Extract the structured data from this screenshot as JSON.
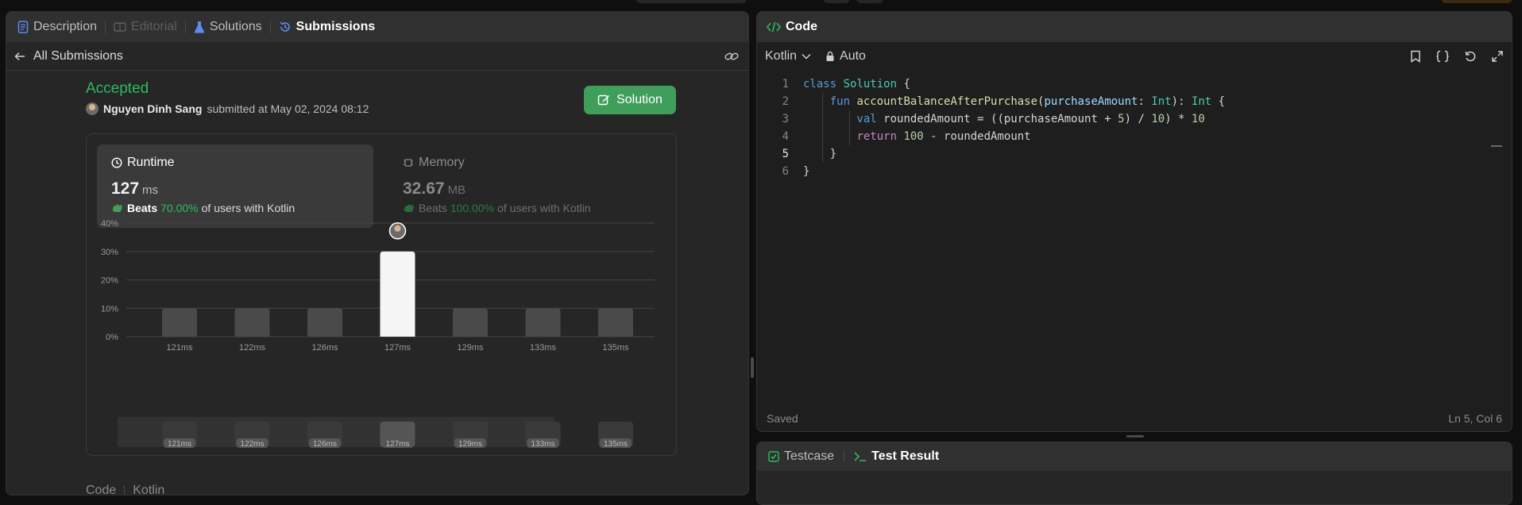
{
  "tabs": [
    {
      "label": "Description",
      "state": "normal",
      "icon": "description-icon"
    },
    {
      "label": "Editorial",
      "state": "disabled",
      "icon": "editorial-icon"
    },
    {
      "label": "Solutions",
      "state": "normal",
      "icon": "flask-icon"
    },
    {
      "label": "Submissions",
      "state": "active",
      "icon": "history-icon"
    }
  ],
  "subbar": {
    "back_label": "All Submissions"
  },
  "submission": {
    "status": "Accepted",
    "user": "Nguyen Dinh Sang",
    "submitted_text": "submitted at May 02, 2024 08:12",
    "solution_button": "Solution"
  },
  "runtime": {
    "title": "Runtime",
    "value": "127",
    "unit": "ms",
    "beats_label": "Beats",
    "beats_pct": "70.00%",
    "beats_suffix": "of users with Kotlin"
  },
  "memory": {
    "title": "Memory",
    "value": "32.67",
    "unit": "MB",
    "beats_label": "Beats",
    "beats_pct": "100.00%",
    "beats_suffix": "of users with Kotlin"
  },
  "chart_data": {
    "type": "bar",
    "categories": [
      "121ms",
      "122ms",
      "126ms",
      "127ms",
      "129ms",
      "133ms",
      "135ms"
    ],
    "values": [
      10,
      10,
      10,
      30,
      10,
      10,
      10
    ],
    "highlighted": "127ms",
    "y_ticks": [
      "0%",
      "10%",
      "20%",
      "30%",
      "40%"
    ],
    "ylim": [
      0,
      40
    ],
    "grid": true
  },
  "bottom_section": {
    "code_label": "Code",
    "lang_label": "Kotlin"
  },
  "code_panel": {
    "title": "Code",
    "language": "Kotlin",
    "mode": "Auto",
    "saved": "Saved",
    "cursor": "Ln 5, Col 6",
    "lines": [
      "class Solution {",
      "    fun accountBalanceAfterPurchase(purchaseAmount: Int): Int {",
      "        val roundedAmount = ((purchaseAmount + 5) / 10) * 10",
      "        return 100 - roundedAmount",
      "    }",
      "}"
    ]
  },
  "test_panel": {
    "testcase_label": "Testcase",
    "result_label": "Test Result"
  },
  "colors": {
    "accent_green": "#2cbb5d",
    "panel_bg": "#262626",
    "code_bg": "#1e1e1e"
  }
}
